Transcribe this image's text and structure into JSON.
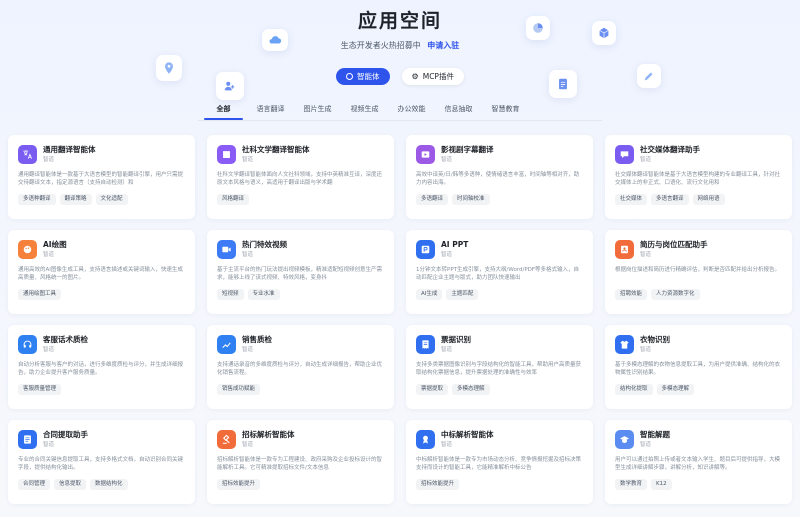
{
  "hero": {
    "title": "应用空间",
    "subtitle": "生态开发者火热招募中",
    "link": "申请入驻"
  },
  "switch": {
    "agent_label": "智能体",
    "mcp_label": "MCP插件"
  },
  "tabs": [
    {
      "label": "全部",
      "active": true
    },
    {
      "label": "语言翻译"
    },
    {
      "label": "图片生成"
    },
    {
      "label": "视频生成"
    },
    {
      "label": "办公效能"
    },
    {
      "label": "信息抽取"
    },
    {
      "label": "智慧教育"
    }
  ],
  "cards": [
    {
      "title": "通用翻译智能体",
      "type": "智道",
      "icon": "translate-icon",
      "color": "#7b5cf0",
      "desc": "通用翻译智能体是一款基于大语言模型的智能翻译引擎，用户只需提交待翻译文本，指定源语言（支持自动检测）和",
      "tags": [
        "多语种翻译",
        "翻译策略",
        "文化适配"
      ]
    },
    {
      "title": "社科文学翻译智能体",
      "type": "智道",
      "icon": "book-icon",
      "color": "#8a5cf6",
      "desc": "社科文学翻译智能体面向人文社科领域，支持中英精准互译，深度还原文本风格与语义，高适用于翻译出版与学术翻",
      "tags": [
        "风格翻译"
      ]
    },
    {
      "title": "影视剧字幕翻译",
      "type": "智道",
      "icon": "film-icon",
      "color": "#9b59e6",
      "desc": "高效中译英/日/韩等多语种，使情绪语言丰富，时间轴等相对齐，助力内容出海。",
      "tags": [
        "多语翻译",
        "时间轴校准"
      ]
    },
    {
      "title": "社交媒体翻译助手",
      "type": "智道",
      "icon": "chat-icon",
      "color": "#7b5cf0",
      "desc": "社交媒体翻译智能体是基于大语言模型构建的专业翻译工具，针对社交媒体上的非正式、口语化、流行文化用和",
      "tags": [
        "社交媒体",
        "多语言翻译",
        "网络用语"
      ]
    },
    {
      "title": "AI绘图",
      "type": "智道",
      "icon": "palette-icon",
      "color": "#f5813a",
      "desc": "通用高效的AI图像生成工具，支持语言描述或关键词输入，快速生成高质量、风格统一的图片。",
      "tags": [
        "通用绘图工具"
      ]
    },
    {
      "title": "热门特效视频",
      "type": "智道",
      "icon": "video-icon",
      "color": "#3c7bf5",
      "desc": "基于主流平台的热门玩法提出视频模板，精准适配短视频创意生产需求，能够上线了该式视频、特效风格，变身抖",
      "tags": [
        "短视频",
        "专业水准"
      ]
    },
    {
      "title": "AI PPT",
      "type": "智道",
      "icon": "ppt-icon",
      "color": "#2f6ff0",
      "desc": "1分钟文本转PPT生成引擎，支持大纲/Word/PDF等多格式输入，自动匹配企业主题与版式，助力团队快速输出",
      "tags": [
        "AI生成",
        "主题匹配"
      ]
    },
    {
      "title": "简历与岗位匹配助手",
      "type": "智道",
      "icon": "resume-icon",
      "color": "#f26b3a",
      "desc": "根据岗位描述和简历进行精确评估，判断是否匹配并给出分析报告。",
      "tags": [
        "招聘效能",
        "人力资源数字化"
      ]
    },
    {
      "title": "客服话术质检",
      "type": "智道",
      "icon": "headset-icon",
      "color": "#2f80f0",
      "desc": "自动分析客服与客户的对话，进行多维度质检与评分，并生成详细报告，助力企业提升客户服务质量。",
      "tags": [
        "客服质量管理"
      ]
    },
    {
      "title": "销售质检",
      "type": "智道",
      "icon": "sales-icon",
      "color": "#2f80f0",
      "desc": "支持通话录音的多维度质检与评分，自动生成详细报告，帮助企业优化销售流程。",
      "tags": [
        "销售成功赋能"
      ]
    },
    {
      "title": "票据识别",
      "type": "智道",
      "icon": "receipt-icon",
      "color": "#2f6ff0",
      "desc": "支持多类票据图像识别与字段结构化的智能工具，帮助用户高质量获取结构化票据信息，提升票据处理的准确性与效率",
      "tags": [
        "票据提取",
        "多模态理解"
      ]
    },
    {
      "title": "衣物识别",
      "type": "智道",
      "icon": "shirt-icon",
      "color": "#2f6ff0",
      "desc": "基于多模态理解的衣物信息提取工具，为用户提供准确、结构化的衣物属性识别结果。",
      "tags": [
        "结构化提取",
        "多模态理解"
      ]
    },
    {
      "title": "合同提取助手",
      "type": "智道",
      "icon": "contract-icon",
      "color": "#2f6ff0",
      "desc": "专业的合同关键信息提取工具，支持多格式文档，自动识别合同关键字段，提供结构化输出。",
      "tags": [
        "合同管理",
        "信息提取",
        "数据结构化"
      ]
    },
    {
      "title": "招标解析智能体",
      "type": "智道",
      "icon": "bid-icon",
      "color": "#f26b3a",
      "desc": "招标解析智能体是一款专为工程建设、政府采购及企业投标设计的智能解析工具。它可精准提取招标文件/文本信息",
      "tags": [
        "招标效能提升"
      ]
    },
    {
      "title": "中标解析智能体",
      "type": "智道",
      "icon": "award-icon",
      "color": "#2f6ff0",
      "desc": "中标解析智能体是一款专为市场动态分析、竞争情报挖掘及招标决策支持而设计的智能工具，它能精准解析中标公告",
      "tags": [
        "招标效能提升"
      ]
    },
    {
      "title": "智能解题",
      "type": "智道",
      "icon": "edu-icon",
      "color": "#5b8cf2",
      "desc": "用户可以通过拍照上传或者文本输入学生、题目后可提供指导，大模型生成详细讲解步骤，讲解分析，知识讲解等。",
      "tags": [
        "数学教育",
        "K12"
      ]
    }
  ]
}
